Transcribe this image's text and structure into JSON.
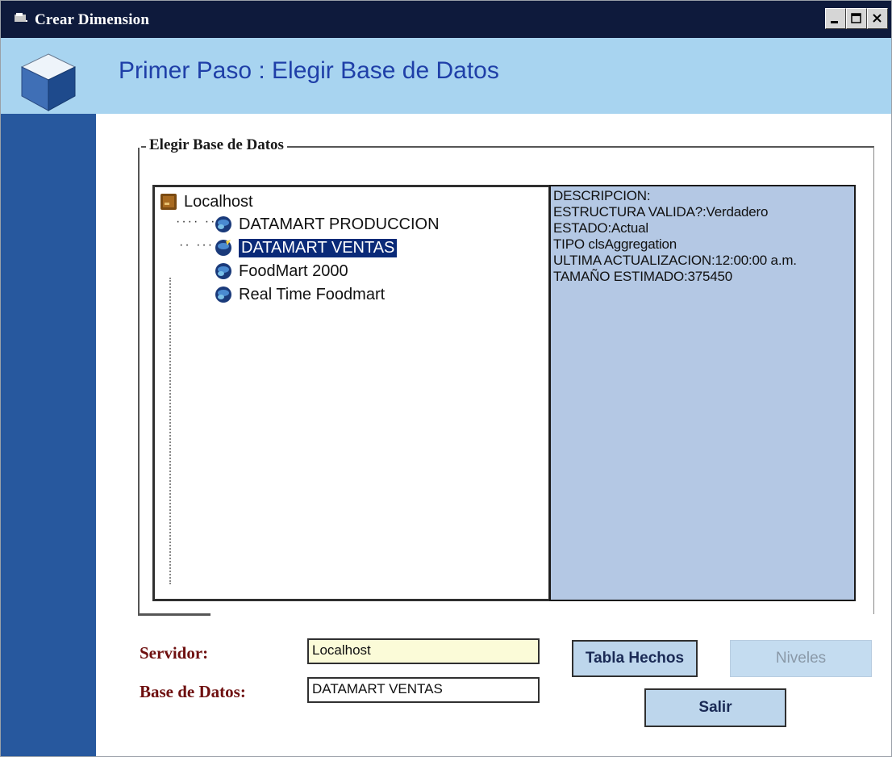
{
  "window": {
    "title": "Crear Dimension"
  },
  "header": {
    "step_title": "Primer Paso :  Elegir Base de Datos"
  },
  "group": {
    "legend": "Elegir Base de Datos"
  },
  "tree": {
    "root": "Localhost",
    "items": [
      {
        "label": "DATAMART PRODUCCION",
        "selected": false
      },
      {
        "label": "DATAMART VENTAS",
        "selected": true
      },
      {
        "label": "FoodMart 2000",
        "selected": false
      },
      {
        "label": "Real Time Foodmart",
        "selected": false
      }
    ]
  },
  "description": {
    "lines": [
      "DESCRIPCION:",
      "ESTRUCTURA VALIDA?:Verdadero",
      "ESTADO:Actual",
      "TIPO clsAggregation",
      "ULTIMA ACTUALIZACION:12:00:00 a.m.",
      "TAMAÑO ESTIMADO:375450"
    ]
  },
  "form": {
    "servidor_label": "Servidor:",
    "servidor_value": "Localhost",
    "base_label": "Base de Datos:",
    "base_value": "DATAMART VENTAS"
  },
  "buttons": {
    "tabla_hechos": "Tabla Hechos",
    "niveles": "Niveles",
    "salir": "Salir"
  },
  "colors": {
    "titlebar": "#0e1a3c",
    "header": "#a8d4f0",
    "sidebar": "#27589e",
    "selection": "#0a2a78",
    "description_bg": "#b4c8e4",
    "label_text": "#6e0f0f"
  }
}
